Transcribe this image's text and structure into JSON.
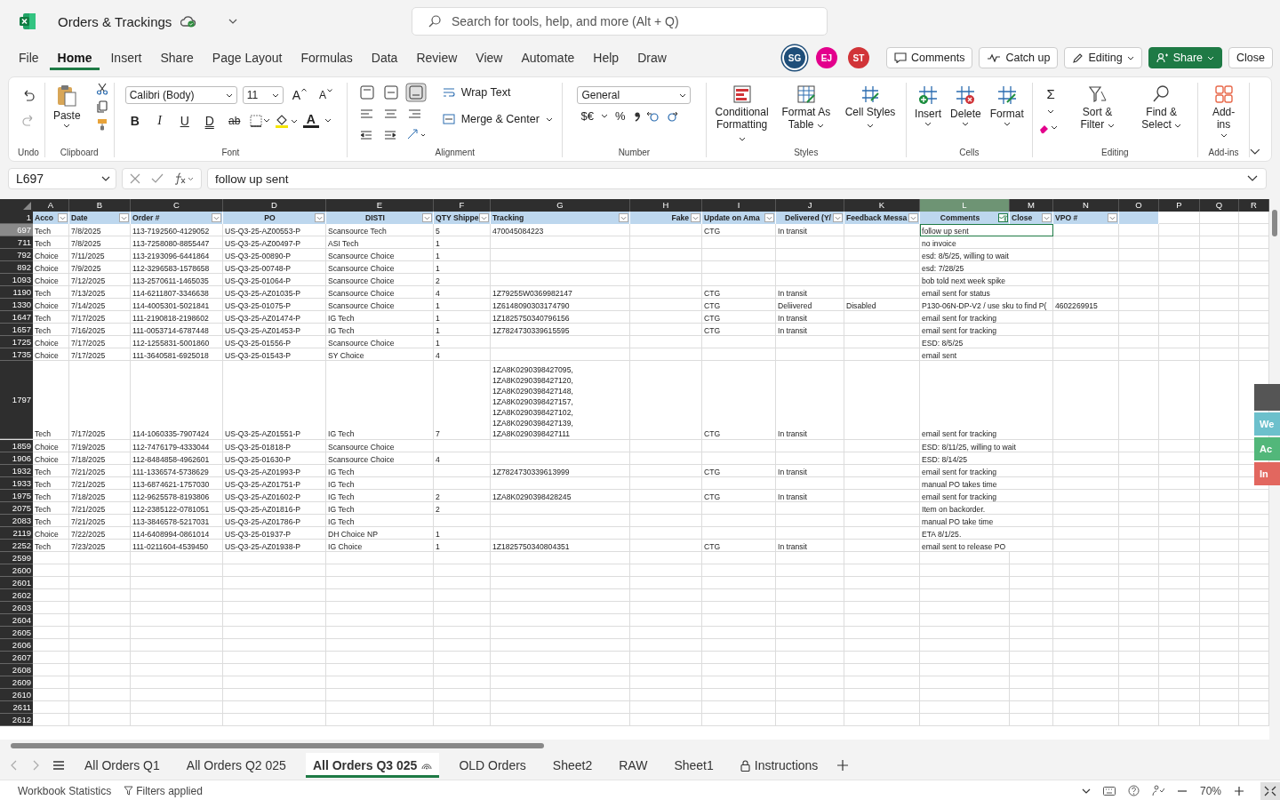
{
  "app": {
    "file_title": "Orders & Trackings",
    "search_placeholder": "Search for tools, help, and more (Alt + Q)"
  },
  "menu_tabs": [
    {
      "label": "File",
      "selected": false
    },
    {
      "label": "Home",
      "selected": true
    },
    {
      "label": "Insert",
      "selected": false
    },
    {
      "label": "Share",
      "selected": false
    },
    {
      "label": "Page Layout",
      "selected": false
    },
    {
      "label": "Formulas",
      "selected": false
    },
    {
      "label": "Data",
      "selected": false
    },
    {
      "label": "Review",
      "selected": false
    },
    {
      "label": "View",
      "selected": false
    },
    {
      "label": "Automate",
      "selected": false
    },
    {
      "label": "Help",
      "selected": false
    },
    {
      "label": "Draw",
      "selected": false
    }
  ],
  "collaborators": [
    {
      "initials": "SG",
      "color": "#1f4e79"
    },
    {
      "initials": "EJ",
      "color": "#e3008c"
    },
    {
      "initials": "ST",
      "color": "#d13438"
    }
  ],
  "header_buttons": [
    {
      "label": "Comments",
      "kind": "comments"
    },
    {
      "label": "Catch up",
      "kind": "catchup"
    },
    {
      "label": "Editing",
      "kind": "editing"
    },
    {
      "label": "Share",
      "kind": "share"
    },
    {
      "label": "Close",
      "kind": "close"
    }
  ],
  "ribbon": {
    "undo": {
      "label": "Undo"
    },
    "clipboard": {
      "label": "Clipboard",
      "paste": "Paste"
    },
    "font": {
      "label": "Font",
      "family": "Calibri (Body)",
      "size": "11",
      "grow": "A",
      "shrink": "A",
      "color_letter": "A",
      "style_buttons": [
        {
          "label": "B",
          "kind": "bold"
        },
        {
          "label": "I",
          "kind": "italic"
        },
        {
          "label": "U",
          "kind": "underline"
        },
        {
          "label": "D",
          "kind": "double"
        },
        {
          "label": "ab",
          "kind": "strike"
        }
      ]
    },
    "alignment": {
      "label": "Alignment",
      "wrap": "Wrap Text",
      "merge": "Merge & Center"
    },
    "number": {
      "label": "Number",
      "format": "General",
      "currency": "$€",
      "percent": "%"
    },
    "styles": {
      "label": "Styles",
      "buttons": [
        {
          "label": "Conditional Formatting",
          "kind": "conditional"
        },
        {
          "label": "Format As Table",
          "kind": "table"
        },
        {
          "label": "Cell Styles",
          "kind": "styles"
        }
      ]
    },
    "cells": {
      "label": "Cells",
      "buttons": [
        {
          "label": "Insert",
          "kind": "insert"
        },
        {
          "label": "Delete",
          "kind": "delete"
        },
        {
          "label": "Format",
          "kind": "format"
        }
      ]
    },
    "editing": {
      "label": "Editing",
      "autosum": "Σ",
      "buttons": [
        {
          "label": "Sort & Filter",
          "kind": "sort"
        },
        {
          "label": "Find & Select",
          "kind": "find"
        }
      ]
    },
    "addins": {
      "label": "Add-ins",
      "button": "Add-ins"
    }
  },
  "formula_bar": {
    "name_box": "L697",
    "formula": "follow up sent"
  },
  "column_letters": [
    {
      "label": "A",
      "selected": false
    },
    {
      "label": "B",
      "selected": false
    },
    {
      "label": "C",
      "selected": false
    },
    {
      "label": "D",
      "selected": false
    },
    {
      "label": "E",
      "selected": false
    },
    {
      "label": "F",
      "selected": false
    },
    {
      "label": "G",
      "selected": false
    },
    {
      "label": "H",
      "selected": false
    },
    {
      "label": "I",
      "selected": false
    },
    {
      "label": "J",
      "selected": false
    },
    {
      "label": "K",
      "selected": false
    },
    {
      "label": "L",
      "selected": true
    },
    {
      "label": "M",
      "selected": false
    },
    {
      "label": "N",
      "selected": false
    },
    {
      "label": "O",
      "selected": false
    },
    {
      "label": "P",
      "selected": false
    },
    {
      "label": "Q",
      "selected": false
    },
    {
      "label": "R",
      "selected": false
    }
  ],
  "header_row": {
    "number": "1",
    "fields": [
      {
        "label": "Acco",
        "filtered": false
      },
      {
        "label": "Date",
        "filtered": false
      },
      {
        "label": "Order #",
        "filtered": false
      },
      {
        "label": "PO",
        "filtered": false
      },
      {
        "label": "DISTI",
        "filtered": false
      },
      {
        "label": "QTY Shippe",
        "filtered": false
      },
      {
        "label": "Tracking",
        "filtered": false
      },
      {
        "label": "Fake",
        "filtered": false
      },
      {
        "label": "Update on Ama",
        "filtered": false
      },
      {
        "label": "Delivered (Y/",
        "filtered": false
      },
      {
        "label": "Feedback Messa",
        "filtered": false
      },
      {
        "label": "Comments",
        "filtered": true
      },
      {
        "label": "Close",
        "filtered": false
      },
      {
        "label": "VPO #",
        "filtered": false
      }
    ]
  },
  "rows": [
    {
      "number": "697",
      "selected": true,
      "account": "Tech",
      "date": "7/8/2025",
      "order": "113-7192560-4129052",
      "po": "US-Q3-25-AZ00553-P",
      "disti": "Scansource Tech",
      "qty": "5",
      "tracking": "470045084223",
      "update": "CTG",
      "delivered": "In transit",
      "comments": "follow up sent"
    },
    {
      "number": "711",
      "selected": false,
      "account": "Tech",
      "date": "7/8/2025",
      "order": "113-7258080-8855447",
      "po": "US-Q3-25-AZ00497-P",
      "disti": "ASI Tech",
      "qty": "1",
      "comments": "no invoice"
    },
    {
      "number": "792",
      "selected": false,
      "account": "Choice",
      "date": "7/11/2025",
      "order": "113-2193096-6441864",
      "po": "US-Q3-25-00890-P",
      "disti": "Scansource Choice",
      "qty": "1",
      "comments": "esd: 8/5/25, willing to wait"
    },
    {
      "number": "892",
      "selected": false,
      "account": "Choice",
      "date": "7/9/2025",
      "order": "112-3296583-1578658",
      "po": "US-Q3-25-00748-P",
      "disti": "Scansource Choice",
      "qty": "1",
      "comments": "esd: 7/28/25"
    },
    {
      "number": "1093",
      "selected": false,
      "account": "Choice",
      "date": "7/12/2025",
      "order": "113-2570611-1465035",
      "po": "US-Q3-25-01064-P",
      "disti": "Scansource Choice",
      "qty": "2",
      "comments": "bob told next week spike"
    },
    {
      "number": "1190",
      "selected": false,
      "account": "Tech",
      "date": "7/13/2025",
      "order": "114-6211807-3346638",
      "po": "US-Q3-25-AZ01035-P",
      "disti": "Scansource Choice",
      "qty": "4",
      "tracking": "1Z79255W0369982147",
      "update": "CTG",
      "delivered": "In transit",
      "comments": "email sent for status"
    },
    {
      "number": "1330",
      "selected": false,
      "account": "Choice",
      "date": "7/14/2025",
      "order": "114-4005301-5021841",
      "po": "US-Q3-25-01075-P",
      "disti": "Scansource Choice",
      "qty": "1",
      "tracking": "1Z6148090303174790",
      "update": "CTG",
      "delivered": "Deliivered",
      "feedback": "Disabled",
      "comments": "P130-06N-DP-V2 / use sku to find P(",
      "vpo": "4602269915"
    },
    {
      "number": "1647",
      "selected": false,
      "account": "Tech",
      "date": "7/17/2025",
      "order": "111-2190818-2198602",
      "po": "US-Q3-25-AZ01474-P",
      "disti": "IG Tech",
      "qty": "1",
      "tracking": "1Z1825750340796156",
      "update": "CTG",
      "delivered": "In transit",
      "comments": "email sent for tracking"
    },
    {
      "number": "1657",
      "selected": false,
      "account": "Tech",
      "date": "7/16/2025",
      "order": "111-0053714-6787448",
      "po": "US-Q3-25-AZ01453-P",
      "disti": "IG Tech",
      "qty": "1",
      "tracking": "1Z7824730339615595",
      "update": "CTG",
      "delivered": "In transit",
      "comments": "email sent for tracking"
    },
    {
      "number": "1725",
      "selected": false,
      "account": "Choice",
      "date": "7/17/2025",
      "order": "112-1255831-5001860",
      "po": "US-Q3-25-01556-P",
      "disti": "Scansource Choice",
      "qty": "1",
      "comments": "ESD: 8/5/25"
    },
    {
      "number": "1735",
      "selected": false,
      "account": "Choice",
      "date": "7/17/2025",
      "order": "111-3640581-6925018",
      "po": "US-Q3-25-01543-P",
      "disti": "SY Choice",
      "qty": "4",
      "comments": "email sent"
    },
    {
      "number": "1797",
      "selected": false,
      "account": "Tech",
      "date": "7/17/2025",
      "order": "114-1060335-7907424",
      "po": "US-Q3-25-AZ01551-P",
      "disti": "IG Tech",
      "qty": "7",
      "tracking": "1ZA8K0290398427095,\n1ZA8K0290398427120,\n1ZA8K0290398427148,\n1ZA8K0290398427157,\n1ZA8K0290398427102,\n1ZA8K0290398427139,\n1ZA8K0290398427111",
      "update": "CTG",
      "delivered": "In transit",
      "comments": "email sent for tracking"
    },
    {
      "number": "1859",
      "selected": false,
      "account": "Choice",
      "date": "7/19/2025",
      "order": "112-7476179-4333044",
      "po": "US-Q3-25-01818-P",
      "disti": "Scansource Choice",
      "comments": "ESD: 8/11/25, willing to wait"
    },
    {
      "number": "1906",
      "selected": false,
      "account": "Choice",
      "date": "7/18/2025",
      "order": "112-8484858-4962601",
      "po": "US-Q3-25-01630-P",
      "disti": "Scansource Choice",
      "qty": "4",
      "comments": "ESD: 8/14/25"
    },
    {
      "number": "1932",
      "selected": false,
      "account": "Tech",
      "date": "7/21/2025",
      "order": "111-1336574-5738629",
      "po": "US-Q3-25-AZ01993-P",
      "disti": "IG Tech",
      "tracking": "1Z7824730339613999",
      "update": "CTG",
      "delivered": "In transit",
      "comments": "email sent for tracking"
    },
    {
      "number": "1933",
      "selected": false,
      "account": "Tech",
      "date": "7/21/2025",
      "order": "113-6874621-1757030",
      "po": "US-Q3-25-AZ01751-P",
      "disti": "IG Tech",
      "comments": "manual PO takes time"
    },
    {
      "number": "1975",
      "selected": false,
      "account": "Tech",
      "date": "7/18/2025",
      "order": "112-9625578-8193806",
      "po": "US-Q3-25-AZ01602-P",
      "disti": "IG Tech",
      "qty": "2",
      "tracking": "1ZA8K0290398428245",
      "update": "CTG",
      "delivered": "In transit",
      "comments": "email sent for tracking"
    },
    {
      "number": "2075",
      "selected": false,
      "account": "Tech",
      "date": "7/21/2025",
      "order": "112-2385122-0781051",
      "po": "US-Q3-25-AZ01816-P",
      "disti": "IG Tech",
      "qty": "2",
      "comments": "Item on backorder."
    },
    {
      "number": "2083",
      "selected": false,
      "account": "Tech",
      "date": "7/21/2025",
      "order": "113-3846578-5217031",
      "po": "US-Q3-25-AZ01786-P",
      "disti": "IG Tech",
      "comments": "manual PO take time"
    },
    {
      "number": "2119",
      "selected": false,
      "account": "Choice",
      "date": "7/22/2025",
      "order": "114-6408994-0861014",
      "po": "US-Q3-25-01937-P",
      "disti": "DH Choice NP",
      "qty": "1",
      "comments": "ETA 8/1/25."
    },
    {
      "number": "2252",
      "selected": false,
      "account": "Tech",
      "date": "7/23/2025",
      "order": "111-0211604-4539450",
      "po": "US-Q3-25-AZ01938-P",
      "disti": "IG Choice",
      "qty": "1",
      "tracking": "1Z1825750340804351",
      "update": "CTG",
      "delivered": "In transit",
      "comments": "email sent to release PO"
    }
  ],
  "empty_rows": [
    "2599",
    "2600",
    "2601",
    "2602",
    "2603",
    "2604",
    "2605",
    "2606",
    "2607",
    "2608",
    "2609",
    "2610",
    "2611",
    "2612"
  ],
  "side_tabs": [
    {
      "text": "We",
      "color": "#6cc0cc"
    },
    {
      "text": "Ac",
      "color": "#52b77a"
    },
    {
      "text": "In",
      "color": "#e2675f"
    }
  ],
  "sheet_tabs": [
    {
      "label": "All Orders Q1",
      "selected": false,
      "kind": "plain"
    },
    {
      "label": "All Orders Q2 025",
      "selected": false,
      "kind": "plain"
    },
    {
      "label": "All Orders Q3 025",
      "selected": true,
      "kind": "shared"
    },
    {
      "label": "OLD Orders",
      "selected": false,
      "kind": "plain"
    },
    {
      "label": "Sheet2",
      "selected": false,
      "kind": "plain"
    },
    {
      "label": "RAW",
      "selected": false,
      "kind": "plain"
    },
    {
      "label": "Sheet1",
      "selected": false,
      "kind": "plain"
    },
    {
      "label": "Instructions",
      "selected": false,
      "kind": "locked"
    }
  ],
  "status_bar": {
    "statistics": "Workbook Statistics",
    "filters": "Filters applied",
    "zoom": "70%"
  }
}
